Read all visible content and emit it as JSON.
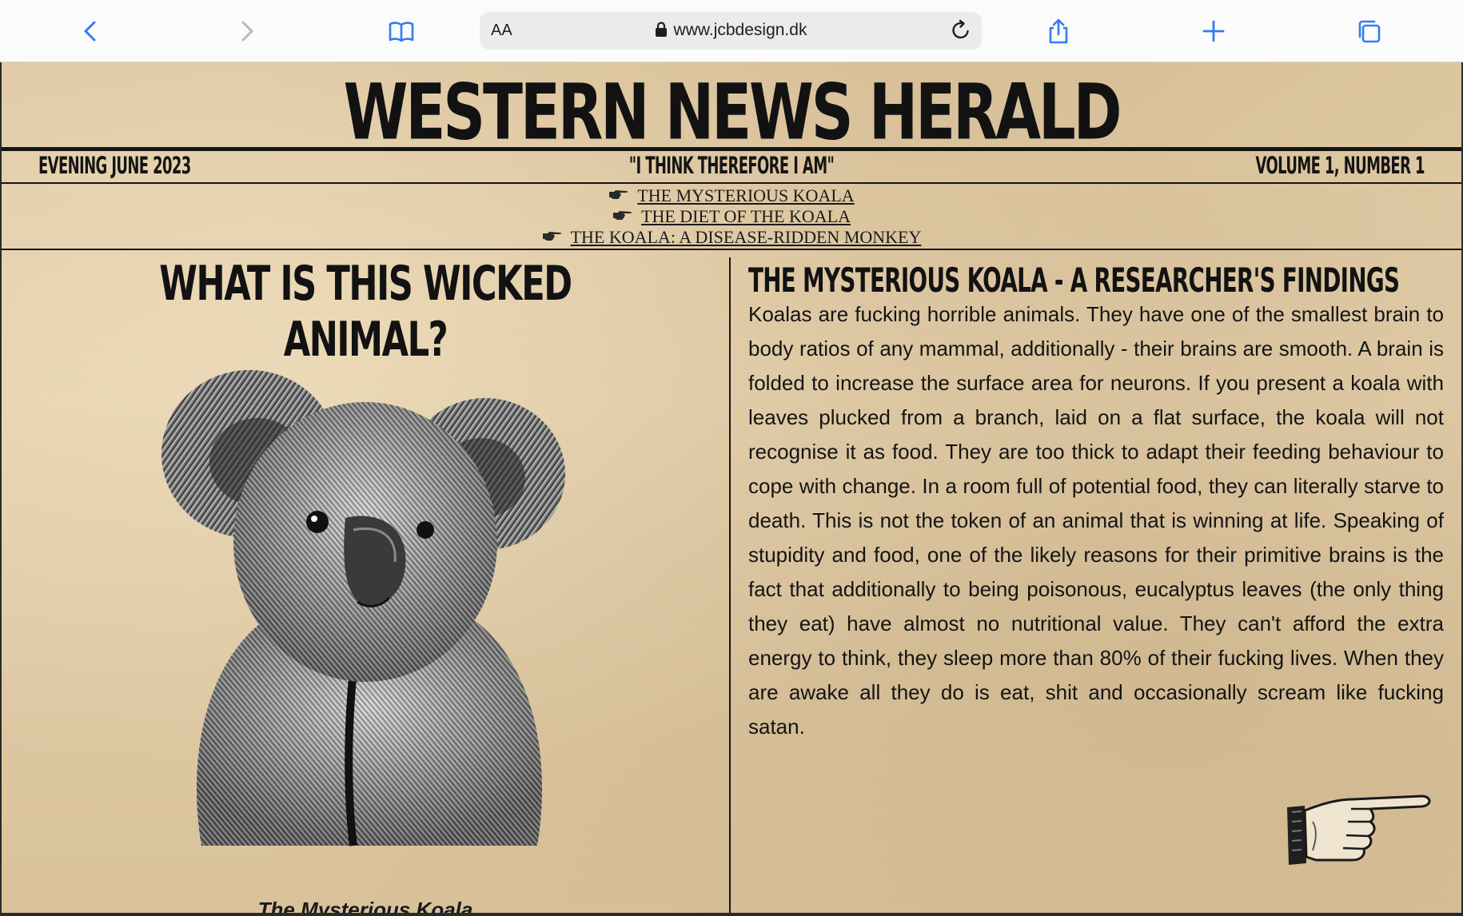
{
  "browser": {
    "aa_label": "AA",
    "url": "www.jcbdesign.dk",
    "icons": [
      "back-icon",
      "forward-icon",
      "bookmarks-icon",
      "lock-icon",
      "reload-icon",
      "share-icon",
      "new-tab-icon",
      "tabs-icon"
    ]
  },
  "newspaper": {
    "masthead": "WESTERN NEWS HERALD",
    "edition": "EVENING JUNE 2023",
    "motto": "\"I THINK THEREFORE I AM\"",
    "volume": "VOLUME 1, NUMBER 1",
    "nav": [
      "THE MYSTERIOUS KOALA",
      "THE DIET OF THE KOALA",
      "THE KOALA: A DISEASE-RIDDEN MONKEY"
    ],
    "left": {
      "headline": "WHAT IS THIS WICKED ANIMAL?",
      "caption": "The Mysterious Koala"
    },
    "right": {
      "headline": "THE MYSTERIOUS KOALA - A RESEARCHER'S FINDINGS",
      "body": "Koalas are fucking horrible animals. They have one of the smallest brain to body ratios of any mammal, additionally - their brains are smooth. A brain is folded to increase the surface area for neurons. If you present a koala with leaves plucked from a branch, laid on a flat surface, the koala will not recognise it as food. They are too thick to adapt their feeding behaviour to cope with change. In a room full of potential food, they can literally starve to death. This is not the token of an animal that is winning at life. Speaking of stupidity and food, one of the likely reasons for their primitive brains is the fact that additionally to being poisonous, eucalyptus leaves (the only thing they eat) have almost no nutritional value. They can't afford the extra energy to think, they sleep more than 80% of their fucking lives. When they are awake all they do is eat, shit and occasionally scream like fucking satan."
    }
  },
  "colors": {
    "accent_blue": "#2f7cf6",
    "paper": "#dcc6a0",
    "ink": "#121212"
  }
}
